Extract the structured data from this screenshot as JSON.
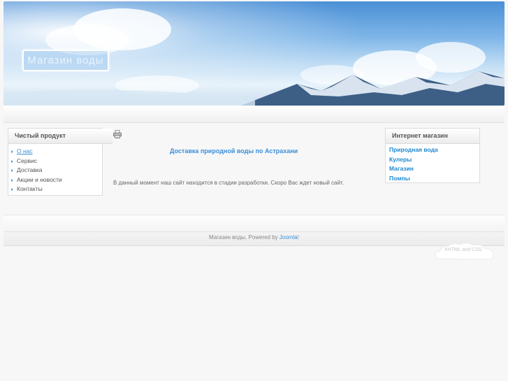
{
  "header": {
    "site_title": "Магазин воды"
  },
  "left_module": {
    "title": "Чистый продукт",
    "items": [
      {
        "label": "О нас"
      },
      {
        "label": "Сервис"
      },
      {
        "label": "Доставка"
      },
      {
        "label": "Акции и новости"
      },
      {
        "label": "Контакты"
      }
    ]
  },
  "right_module": {
    "title": "Интернет магазин",
    "items": [
      {
        "label": "Природная вода"
      },
      {
        "label": "Кулеры"
      },
      {
        "label": "Магазин"
      },
      {
        "label": "Помпы"
      }
    ]
  },
  "article": {
    "print_icon": "printer-icon",
    "title": "Доставка природной воды по Астрахани",
    "text": "В данный момент наш сайт находится в стадии разработки. Скоро Вас ждет новый сайт."
  },
  "footer": {
    "prefix": "Магазин воды, Powered by ",
    "link": "Joomla",
    "suffix": "!",
    "badge": "XHTML and CSS"
  },
  "colors": {
    "accent": "#1e88d2",
    "title_blue": "#3a8fd8"
  }
}
